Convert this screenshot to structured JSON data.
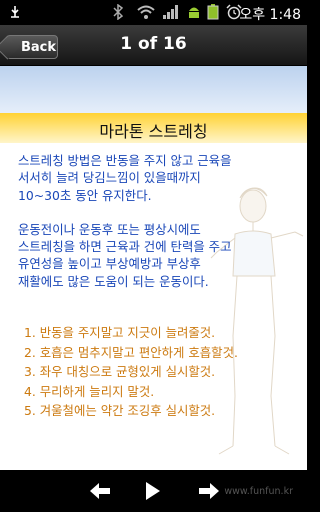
{
  "status_bar": {
    "time": "오후 1:48",
    "icons": [
      "usb-icon",
      "bluetooth-icon",
      "wifi-icon",
      "signal-icon",
      "android-icon",
      "battery-icon",
      "alarm-icon"
    ]
  },
  "header": {
    "back_label": "Back",
    "page_counter": "1 of 16"
  },
  "article": {
    "title": "마라톤 스트레칭",
    "paragraphs": [
      "스트레칭 방법은 반동을 주지 않고 근육을\n서서히 늘려 당김느낌이 있을때까지\n10~30초 동안 유지한다.",
      "운동전이나 운동후 또는 평상시에도\n스트레칭을 하면 근육과 건에 탄력을 주고\n유연성을 높이고 부상예방과 부상후\n재활에도 많은 도움이 되는 운동이다."
    ],
    "rules": [
      "1. 반동을 주지말고 지긋이 늘려줄것.",
      "2. 호흡은 멈추지말고 편안하게 호흡할것.",
      "3. 좌우 대칭으로 균형있게 실시할것.",
      "4. 무리하게 늘리지 말것.",
      "5. 겨울철에는 약간 조깅후 실시할것."
    ]
  },
  "bottom_nav": {
    "buttons": [
      "previous-icon",
      "play-icon",
      "next-icon"
    ],
    "watermark": "www.funfun.kr"
  },
  "colors": {
    "paragraph_text": "#1a47b8",
    "rules_text": "#cc7a10",
    "heading_band": "#ffd233"
  }
}
